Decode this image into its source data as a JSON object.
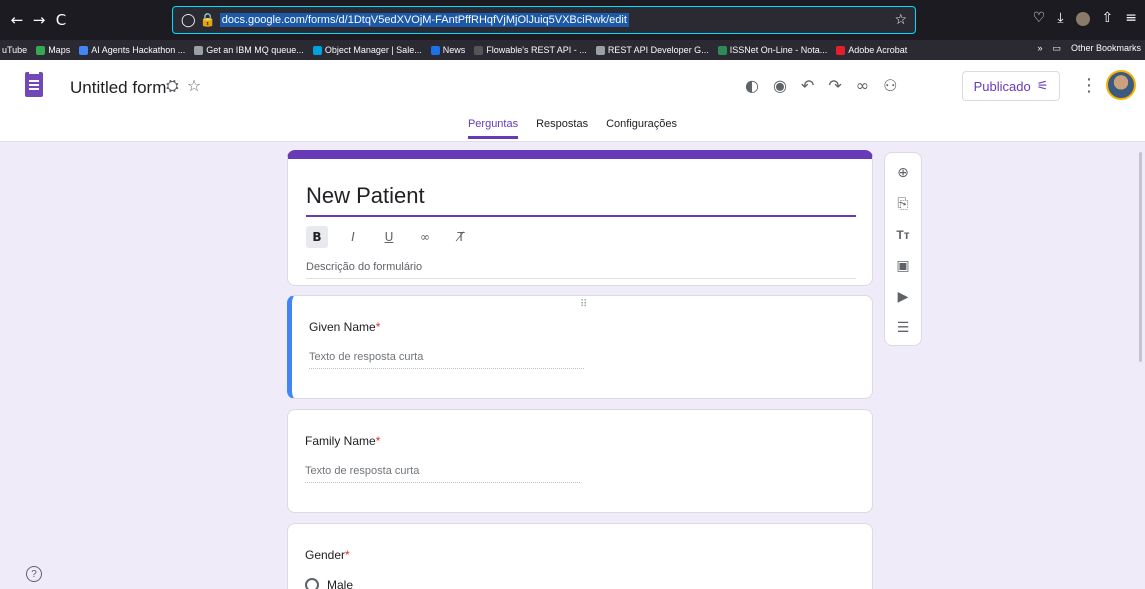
{
  "browser": {
    "url": "docs.google.com/forms/d/1DtqV5edXVOjM-FAntPffRHqfVjMjOlJuiq5VXBciRwk/edit",
    "nav_back": "←",
    "nav_forward": "→",
    "nav_reload": "C",
    "bookmarks": [
      {
        "label": "uTube",
        "color": "#ff0000"
      },
      {
        "label": "Maps",
        "color": "#34a853"
      },
      {
        "label": "AI Agents Hackathon ...",
        "color": "#4285f4"
      },
      {
        "label": "Get an IBM MQ queue...",
        "color": "#9aa0a6"
      },
      {
        "label": "Object Manager | Sale...",
        "color": "#00a1e0"
      },
      {
        "label": "News",
        "color": "#1a73e8"
      },
      {
        "label": "Flowable's REST API - ...",
        "color": "#555555"
      },
      {
        "label": "REST API Developer G...",
        "color": "#9aa0a6"
      },
      {
        "label": "ISSNet On-Line - Nota...",
        "color": "#2e8b57"
      },
      {
        "label": "Adobe Acrobat",
        "color": "#e41e2b"
      }
    ],
    "other_bookmarks": "Other Bookmarks"
  },
  "header": {
    "title": "Untitled form",
    "publish_label": "Publicado",
    "tabs": [
      "Perguntas",
      "Respostas",
      "Configurações"
    ],
    "active_tab": "Perguntas"
  },
  "form": {
    "title": "New Patient",
    "description_placeholder": "Descrição do formulário",
    "questions": [
      {
        "label": "Given Name",
        "answer_placeholder": "Texto de resposta curta"
      },
      {
        "label": "Family Name",
        "answer_placeholder": "Texto de resposta curta"
      },
      {
        "label": "Gender",
        "option": "Male"
      }
    ],
    "required_marker": "*"
  },
  "icons": {
    "side_toolbar": [
      "add-question-icon",
      "import-questions-icon",
      "add-title-icon",
      "add-image-icon",
      "add-video-icon",
      "add-section-icon"
    ],
    "header_actions": [
      "palette-icon",
      "preview-icon",
      "undo-icon",
      "redo-icon",
      "link-icon",
      "add-collaborator-icon"
    ]
  },
  "colors": {
    "accent": "#673ab7",
    "background": "#f0ebf8",
    "active_question": "#4285f4",
    "required": "#d93025"
  }
}
